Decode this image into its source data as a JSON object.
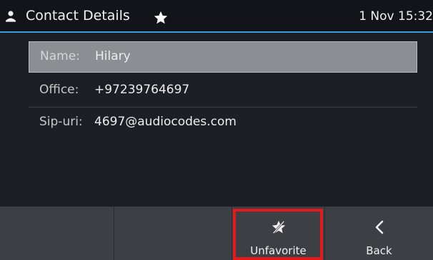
{
  "header": {
    "title": "Contact Details",
    "datetime": "1 Nov 15:32",
    "user_icon": "user-icon",
    "favorite_icon": "star-icon"
  },
  "contact": {
    "fields": [
      {
        "label": "Name:",
        "value": "Hilary"
      },
      {
        "label": "Office:",
        "value": "+97239764697"
      },
      {
        "label": "Sip-uri:",
        "value": "4697@audiocodes.com"
      }
    ]
  },
  "softkeys": {
    "unfavorite": {
      "label": "Unfavorite",
      "icon": "unfavorite-star-icon"
    },
    "back": {
      "label": "Back",
      "icon": "chevron-left-icon"
    }
  },
  "colors": {
    "accent": "#3aa0e0",
    "highlight": "#e3191b",
    "selected_row": "#8b8e92"
  }
}
